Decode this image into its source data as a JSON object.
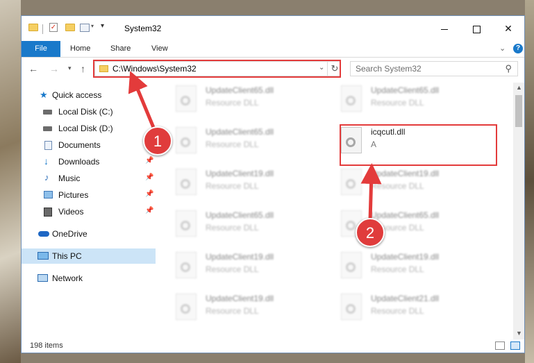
{
  "window": {
    "title": "System32",
    "accent_color": "#1979ca",
    "annotation_color": "#e33b3b"
  },
  "ribbon": {
    "tabs": [
      "File",
      "Home",
      "Share",
      "View"
    ],
    "help_label": "?"
  },
  "navigation": {
    "address": "C:\\Windows\\System32",
    "search_placeholder": "Search System32"
  },
  "sidebar": {
    "items": [
      {
        "label": "Quick access",
        "icon": "star-icon"
      },
      {
        "label": "Local Disk (C:)",
        "icon": "drive-icon"
      },
      {
        "label": "Local Disk (D:)",
        "icon": "drive-icon"
      },
      {
        "label": "Documents",
        "icon": "documents-icon",
        "pinned": true
      },
      {
        "label": "Downloads",
        "icon": "download-icon",
        "pinned": true
      },
      {
        "label": "Music",
        "icon": "music-icon",
        "pinned": true
      },
      {
        "label": "Pictures",
        "icon": "pictures-icon",
        "pinned": true
      },
      {
        "label": "Videos",
        "icon": "videos-icon",
        "pinned": true
      },
      {
        "label": "OneDrive",
        "icon": "cloud-icon"
      },
      {
        "label": "This PC",
        "icon": "computer-icon",
        "selected": true
      },
      {
        "label": "Network",
        "icon": "network-icon"
      }
    ]
  },
  "files": [
    {
      "name": "UpdateClient65.dll",
      "type": "Resource DLL"
    },
    {
      "name": "UpdateClient65.dll",
      "type": "Resource DLL"
    },
    {
      "name": "UpdateClient65.dll",
      "type": "Resource DLL"
    },
    {
      "name": "icqcutl.dll",
      "type": "A",
      "highlighted": true
    },
    {
      "name": "UpdateClient19.dll",
      "type": "Resource DLL"
    },
    {
      "name": "UpdateClient19.dll",
      "type": "Resource DLL"
    },
    {
      "name": "UpdateClient65.dll",
      "type": "Resource DLL"
    },
    {
      "name": "UpdateClient65.dll",
      "type": "Resource DLL"
    },
    {
      "name": "UpdateClient19.dll",
      "type": "Resource DLL"
    },
    {
      "name": "UpdateClient19.dll",
      "type": "Resource DLL"
    },
    {
      "name": "UpdateClient19.dll",
      "type": "Resource DLL"
    },
    {
      "name": "UpdateClient21.dll",
      "type": "Resource DLL"
    }
  ],
  "status": {
    "item_count": "198 items"
  },
  "annotations": {
    "step1": "1",
    "step2": "2"
  }
}
